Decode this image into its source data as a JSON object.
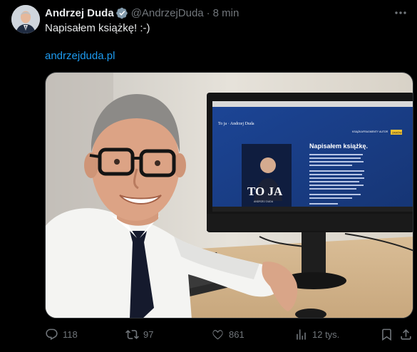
{
  "tweet": {
    "author_name": "Andrzej Duda",
    "author_handle": "@AndrzejDuda",
    "separator": "·",
    "time": "8 min",
    "text": "Napisałem książkę! :-)",
    "link_text": "andrzejduda.pl"
  },
  "media": {
    "screen_heading": "Napisałem książkę.",
    "screen_logo": "To ja · Andrzej Duda",
    "book_title": "TO JA",
    "book_author": "ANDRZEJ DUDA",
    "nav_items": [
      "KSIĄŻKA",
      "FRAGMENTY",
      "AUTOR"
    ],
    "buy_button": "ZAMÓW"
  },
  "actions": {
    "replies": "118",
    "reposts": "97",
    "likes": "861",
    "views": "12 tys."
  },
  "colors": {
    "accent": "#1d9bf0",
    "muted": "#71767b",
    "screen_blue": "#1a3d8c",
    "buy_yellow": "#f2c230"
  },
  "icons": [
    "verified-badge-icon",
    "more-icon",
    "reply-icon",
    "repost-icon",
    "like-icon",
    "views-icon",
    "bookmark-icon",
    "share-icon"
  ]
}
